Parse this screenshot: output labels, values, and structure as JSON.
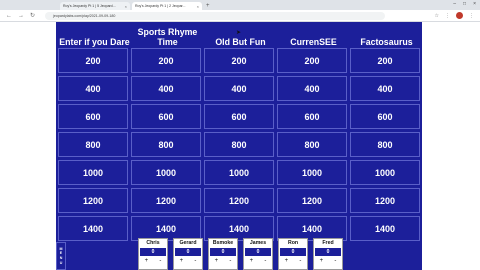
{
  "browser": {
    "tabs": [
      {
        "title": "Roy's Jeopardy Pt 1 | 5 Jeopard..."
      },
      {
        "title": "Roy's Jeopardy Pt 1 | 2 Jeopar..."
      }
    ],
    "url": "jeopardylabs.com/play/2021-09-09-180"
  },
  "board": {
    "categories": [
      {
        "line1": "",
        "line2": "Enter if you Dare"
      },
      {
        "line1": "Sports Rhyme",
        "line2": "Time"
      },
      {
        "line1": "",
        "line2": "Old But Fun"
      },
      {
        "line1": "",
        "line2": "CurrenSEE"
      },
      {
        "line1": "",
        "line2": "Factosaurus"
      }
    ],
    "values": [
      "200",
      "400",
      "600",
      "800",
      "1000",
      "1200",
      "1400"
    ]
  },
  "menu_label": "M\nE\nN\nU",
  "players": [
    {
      "name": "Chris",
      "score": "0"
    },
    {
      "name": "Gerard",
      "score": "0"
    },
    {
      "name": "Bsmoke",
      "score": "0"
    },
    {
      "name": "James",
      "score": "0"
    },
    {
      "name": "Ron",
      "score": "0"
    },
    {
      "name": "Fred",
      "score": "0"
    }
  ],
  "controls": {
    "plus": "+",
    "minus": "-"
  },
  "colors": {
    "board": "#1c1f9a",
    "cell_border": "#5a5fc8",
    "text": "#ffffff"
  }
}
